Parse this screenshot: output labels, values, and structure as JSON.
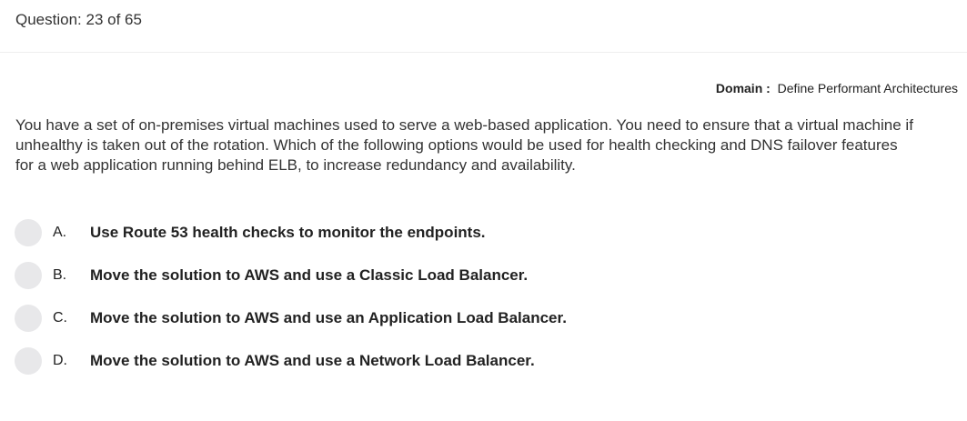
{
  "header": {
    "question_counter": "Question: 23 of 65"
  },
  "domain": {
    "label": "Domain :",
    "value": "Define Performant Architectures"
  },
  "question": {
    "text": "You have a set of on-premises virtual machines used to serve a web-based application. You need to ensure that a virtual machine if unhealthy is taken out of the rotation. Which of the following options would be used for health checking and DNS failover features for a web application running behind  ELB, to increase redundancy and availability."
  },
  "options": [
    {
      "letter": "A.",
      "text": "Use Route 53 health checks to monitor the endpoints."
    },
    {
      "letter": "B.",
      "text": "Move the solution to AWS and use a Classic Load Balancer."
    },
    {
      "letter": "C.",
      "text": "Move the solution to AWS and use an Application Load Balancer."
    },
    {
      "letter": "D.",
      "text": "Move the solution to AWS and use a Network Load Balancer."
    }
  ]
}
